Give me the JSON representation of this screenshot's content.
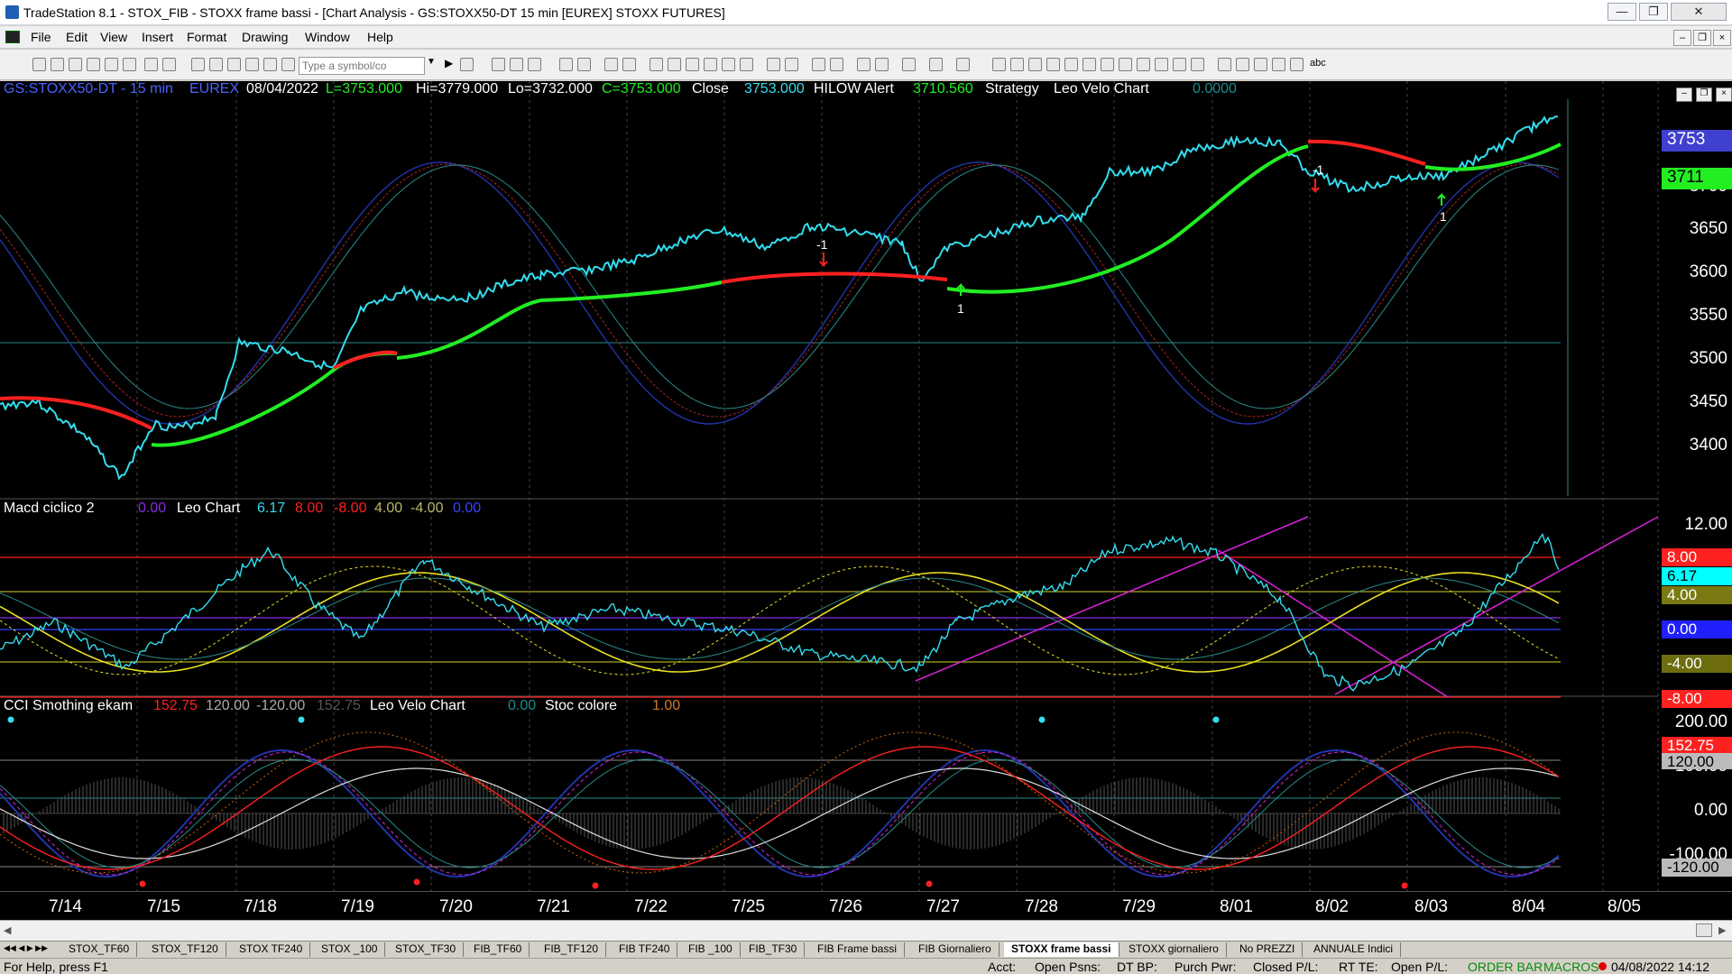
{
  "title": "TradeStation 8.1 - STOX_FIB - STOXX frame bassi - [Chart Analysis - GS:STOXX50-DT  15 min  [EUREX] STOXX FUTURES]",
  "menu": [
    "File",
    "Edit",
    "View",
    "Insert",
    "Format",
    "Drawing",
    "Window",
    "Help"
  ],
  "symbol_placeholder": "Type a symbol/co",
  "header": {
    "symbol": "GS:STOXX50-DT - 15 min",
    "exchange": "EUREX",
    "date": "08/04/2022",
    "last": "L=3753.000",
    "hi": "Hi=3779.000",
    "lo": "Lo=3732.000",
    "close_val": "C=3753.000",
    "close_lbl": "Close",
    "close_num": "3753.000",
    "hilow": "HILOW Alert",
    "hilow_val": "3710.560",
    "strategy": "Strategy",
    "leo": "Leo Velo Chart",
    "leo_val": "0.0000"
  },
  "macd": {
    "title": "Macd ciclico 2",
    "v0": "0.00",
    "leo": "Leo Chart",
    "a": "6.17",
    "b": "8.00",
    "c": "-8.00",
    "d": "4.00",
    "e": "-4.00",
    "f": "0.00"
  },
  "cci": {
    "title": "CCI Smothing ekam",
    "a": "152.75",
    "b": "120.00",
    "c": "-120.00",
    "d": "152.75",
    "leo": "Leo Velo Chart",
    "e": "0.00",
    "stoc": "Stoc colore",
    "f": "1.00"
  },
  "price_axis": [
    "3700",
    "3650",
    "3600",
    "3550",
    "3500",
    "3450",
    "3400"
  ],
  "price_badges": {
    "last": "3753",
    "hilow": "3711"
  },
  "macd_axis": [
    "12.00",
    "4.00",
    "-4.00"
  ],
  "macd_badges": {
    "b8": "8.00",
    "b617": "6.17",
    "b0": "0.00",
    "bm8": "-8.00"
  },
  "cci_axis": [
    "200.00",
    "100.00",
    "0.00",
    "-100.00"
  ],
  "cci_badges": {
    "a": "152.75",
    "b": "120.00",
    "c": "-120.00"
  },
  "dates": [
    "7/14",
    "7/15",
    "7/18",
    "7/19",
    "7/20",
    "7/21",
    "7/22",
    "7/25",
    "7/26",
    "7/27",
    "7/28",
    "7/29",
    "8/01",
    "8/02",
    "8/03",
    "8/04",
    "8/05"
  ],
  "signals": {
    "s1": "-1",
    "s2": "1",
    "s3": "-1",
    "s4": "1"
  },
  "tabs": [
    "STOX_TF60",
    "STOX_TF120",
    "STOX TF240",
    "STOX _100",
    "STOX_TF30",
    "FIB_TF60",
    "FIB_TF120",
    "FIB TF240",
    "FIB _100",
    "FIB_TF30",
    "FIB Frame bassi",
    "FIB Giornaliero",
    "STOXX frame bassi",
    "STOXX giornaliero",
    "No PREZZI",
    "ANNUALE Indici"
  ],
  "status": {
    "help": "For Help, press F1",
    "acct": "Acct:",
    "psns": "Open Psns:",
    "dtbp": "DT BP:",
    "purch": "Purch Pwr:",
    "closed": "Closed P/L:",
    "rtte": "RT TE:",
    "open": "Open P/L:",
    "order": "ORDER BAR",
    "macros": "MACROS",
    "datetime": "04/08/2022 14:12"
  },
  "colors": {
    "cyan": "#33ddee",
    "green": "#22ee22",
    "red": "#ff2020",
    "yellow": "#e8e020",
    "magenta": "#dd22dd",
    "navy": "#2233aa",
    "teal": "#2a8a8a"
  }
}
